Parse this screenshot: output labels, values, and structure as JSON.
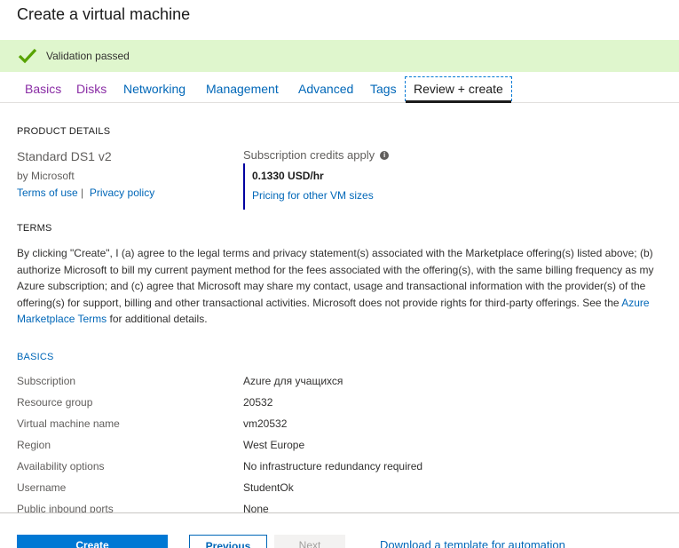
{
  "page": {
    "title": "Create a virtual machine"
  },
  "validation": {
    "message": "Validation passed",
    "icon": "checkmark-icon",
    "color": "#57a300"
  },
  "tabs": [
    {
      "label": "Basics",
      "state": "visited"
    },
    {
      "label": "Disks",
      "state": "visited"
    },
    {
      "label": "Networking",
      "state": "normal"
    },
    {
      "label": "Management",
      "state": "normal"
    },
    {
      "label": "Advanced",
      "state": "normal"
    },
    {
      "label": "Tags",
      "state": "normal"
    },
    {
      "label": "Review + create",
      "state": "active"
    }
  ],
  "product": {
    "heading": "PRODUCT DETAILS",
    "name": "Standard DS1 v2",
    "publisher": "by Microsoft",
    "terms_link": "Terms of use",
    "separator": "|",
    "privacy_link": "Privacy policy",
    "credits_label": "Subscription credits apply",
    "price": "0.1330 USD/hr",
    "pricing_link": "Pricing for other VM sizes"
  },
  "terms": {
    "heading": "TERMS",
    "body": "By clicking \"Create\", I (a) agree to the legal terms and privacy statement(s) associated with the Marketplace offering(s) listed above; (b) authorize Microsoft to bill my current payment method for the fees associated with the offering(s), with the same billing frequency as my Azure subscription; and (c) agree that Microsoft may share my contact, usage and transactional information with the provider(s) of the offering(s) for support, billing and other transactional activities. Microsoft does not provide rights for third-party offerings. See the ",
    "marketplace_link": "Azure Marketplace Terms",
    "suffix": " for additional details."
  },
  "basics": {
    "heading": "BASICS",
    "rows": [
      {
        "label": "Subscription",
        "value": "Azure для учащихся"
      },
      {
        "label": "Resource group",
        "value": "20532"
      },
      {
        "label": "Virtual machine name",
        "value": "vm20532"
      },
      {
        "label": "Region",
        "value": "West Europe"
      },
      {
        "label": "Availability options",
        "value": "No infrastructure redundancy required"
      },
      {
        "label": "Username",
        "value": "StudentOk"
      },
      {
        "label": "Public inbound ports",
        "value": "None"
      }
    ]
  },
  "footer": {
    "create": "Create",
    "previous": "Previous",
    "next": "Next",
    "download": "Download a template for automation"
  }
}
